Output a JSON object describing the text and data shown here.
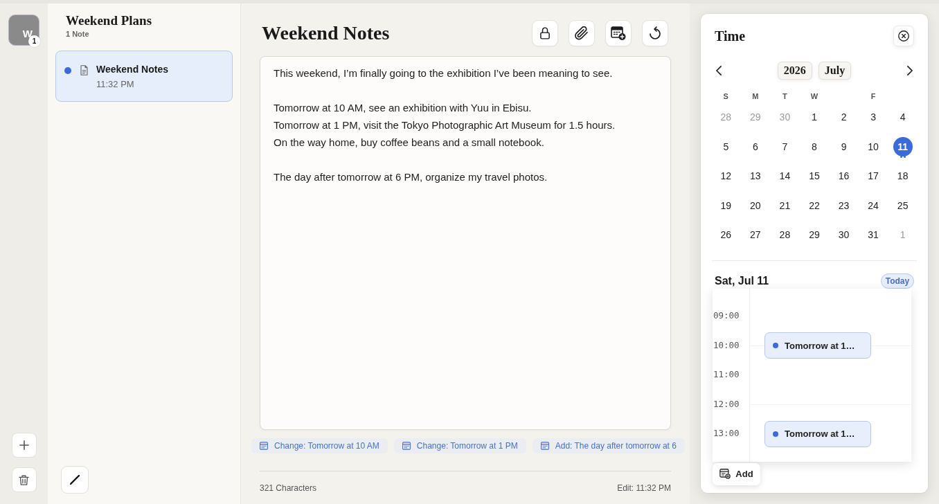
{
  "workspace": {
    "initial": "W",
    "badge": "1"
  },
  "note_list": {
    "title": "Weekend Plans",
    "count": "1 Note",
    "notes": [
      {
        "title": "Weekend Notes",
        "time": "11:32 PM",
        "selected": true,
        "unread": true
      }
    ]
  },
  "editor": {
    "title": "Weekend Notes",
    "paragraphs": [
      {
        "lines": [
          "This weekend, I’m finally going to the exhibition I’ve been meaning to see."
        ]
      },
      {
        "lines": [
          "Tomorrow at 10 AM, see an exhibition with Yuu in Ebisu.",
          "Tomorrow at 1 PM, visit the Tokyo Photographic Art Museum for 1.5 hours.",
          "On the way home, buy coffee beans and a small notebook."
        ]
      },
      {
        "lines": [
          "The day after tomorrow at 6 PM, organize my travel photos."
        ]
      }
    ],
    "suggestions": [
      "Change: Tomorrow at 10 AM",
      "Change: Tomorrow at 1 PM",
      "Add: The day after tomorrow at 6"
    ],
    "character_count": "321 Characters",
    "edited": "Edit: 11:32 PM"
  },
  "time_panel": {
    "title": "Time",
    "year": "2026",
    "month": "July",
    "weekdays": {
      "sunday": "S",
      "monday": "M",
      "tuesday": "T",
      "wednesday": "W",
      "friday": "F"
    },
    "days": [
      {
        "label": "28",
        "outside": true,
        "selected": false,
        "has_events": false
      },
      {
        "label": "29",
        "outside": true,
        "selected": false,
        "has_events": false
      },
      {
        "label": "30",
        "outside": true,
        "selected": false,
        "has_events": false
      },
      {
        "label": "1",
        "outside": false,
        "selected": false,
        "has_events": false
      },
      {
        "label": "2",
        "outside": false,
        "selected": false,
        "has_events": false
      },
      {
        "label": "3",
        "outside": false,
        "selected": false,
        "has_events": false
      },
      {
        "label": "4",
        "outside": false,
        "selected": false,
        "has_events": false
      },
      {
        "label": "5",
        "outside": false,
        "selected": false,
        "has_events": false
      },
      {
        "label": "6",
        "outside": false,
        "selected": false,
        "has_events": false
      },
      {
        "label": "7",
        "outside": false,
        "selected": false,
        "has_events": false
      },
      {
        "label": "8",
        "outside": false,
        "selected": false,
        "has_events": false
      },
      {
        "label": "9",
        "outside": false,
        "selected": false,
        "has_events": false
      },
      {
        "label": "10",
        "outside": false,
        "selected": false,
        "has_events": false
      },
      {
        "label": "11",
        "outside": false,
        "selected": true,
        "has_events": true
      },
      {
        "label": "12",
        "outside": false,
        "selected": false,
        "has_events": false
      },
      {
        "label": "13",
        "outside": false,
        "selected": false,
        "has_events": false
      },
      {
        "label": "14",
        "outside": false,
        "selected": false,
        "has_events": false
      },
      {
        "label": "15",
        "outside": false,
        "selected": false,
        "has_events": false
      },
      {
        "label": "16",
        "outside": false,
        "selected": false,
        "has_events": false
      },
      {
        "label": "17",
        "outside": false,
        "selected": false,
        "has_events": false
      },
      {
        "label": "18",
        "outside": false,
        "selected": false,
        "has_events": false
      },
      {
        "label": "19",
        "outside": false,
        "selected": false,
        "has_events": false
      },
      {
        "label": "20",
        "outside": false,
        "selected": false,
        "has_events": false
      },
      {
        "label": "21",
        "outside": false,
        "selected": false,
        "has_events": false
      },
      {
        "label": "22",
        "outside": false,
        "selected": false,
        "has_events": false
      },
      {
        "label": "23",
        "outside": false,
        "selected": false,
        "has_events": false
      },
      {
        "label": "24",
        "outside": false,
        "selected": false,
        "has_events": false
      },
      {
        "label": "25",
        "outside": false,
        "selected": false,
        "has_events": false
      },
      {
        "label": "26",
        "outside": false,
        "selected": false,
        "has_events": false
      },
      {
        "label": "27",
        "outside": false,
        "selected": false,
        "has_events": false
      },
      {
        "label": "28",
        "outside": false,
        "selected": false,
        "has_events": false
      },
      {
        "label": "29",
        "outside": false,
        "selected": false,
        "has_events": false
      },
      {
        "label": "30",
        "outside": false,
        "selected": false,
        "has_events": false
      },
      {
        "label": "31",
        "outside": false,
        "selected": false,
        "has_events": false
      },
      {
        "label": "1",
        "outside": true,
        "selected": false,
        "has_events": false
      }
    ],
    "day_title": "Sat, Jul 11",
    "today_button": "Today",
    "hours": [
      {
        "label": "09:00"
      },
      {
        "label": "10:00",
        "events": [
          {
            "title": "Tomorrow at 1…"
          }
        ]
      },
      {
        "label": "11:00"
      },
      {
        "label": "12:00"
      },
      {
        "label": "13:00",
        "events": [
          {
            "title": "Tomorrow at 1…"
          }
        ]
      }
    ],
    "add_button": "Add"
  }
}
